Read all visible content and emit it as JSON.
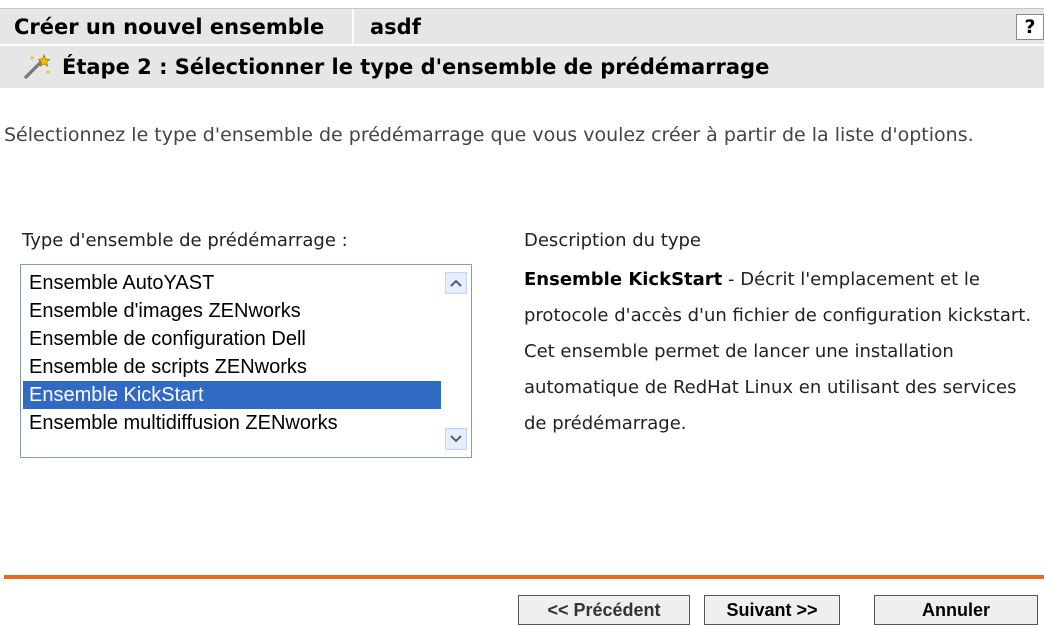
{
  "header": {
    "title": "Créer un nouvel ensemble",
    "bundle_name": "asdf",
    "help_label": "?"
  },
  "step": {
    "icon": "wand-icon",
    "title": "Étape 2 : Sélectionner le type d'ensemble de prédémarrage"
  },
  "intro": "Sélectionnez le type d'ensemble de prédémarrage que vous voulez créer à partir de la liste d'options.",
  "list": {
    "label": "Type d'ensemble de prédémarrage :",
    "items": [
      "Ensemble AutoYAST",
      "Ensemble d'images ZENworks",
      "Ensemble de configuration Dell",
      "Ensemble de scripts ZENworks",
      "Ensemble KickStart",
      "Ensemble multidiffusion ZENworks"
    ],
    "selected": "Ensemble KickStart",
    "selection_color": "#316ac5"
  },
  "description": {
    "heading": "Description du type",
    "name": "Ensemble KickStart",
    "text": " - Décrit l'emplacement et le protocole d'accès d'un fichier de configuration kickstart. Cet ensemble permet de lancer une installation automatique de RedHat Linux en utilisant des services de prédémarrage."
  },
  "buttons": {
    "previous": "<< Précédent",
    "next": "Suivant >>",
    "cancel": "Annuler"
  },
  "colors": {
    "accent_rule": "#e36b25",
    "header_bg": "#e6e6e6"
  }
}
